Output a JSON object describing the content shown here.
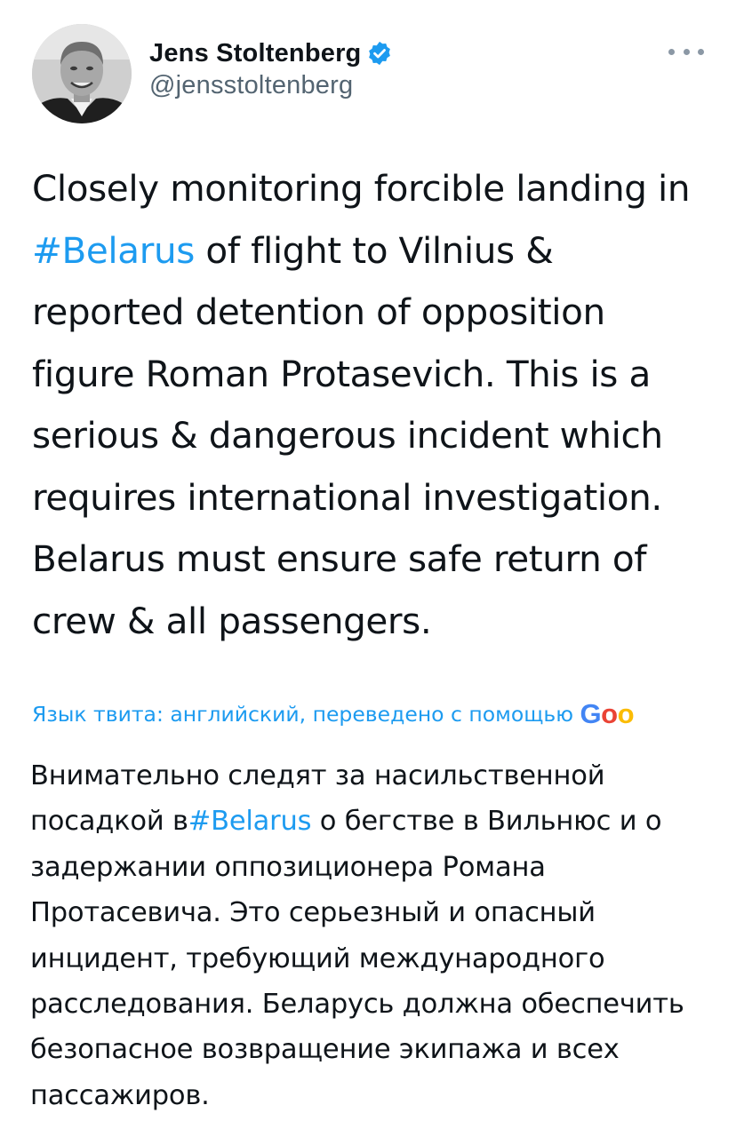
{
  "author": {
    "display_name": "Jens Stoltenberg",
    "handle": "@jensstoltenberg",
    "verified_icon": "verified-badge-icon",
    "avatar_icon": "profile-photo"
  },
  "more_icon": "more-options-icon",
  "tweet": {
    "lines": [
      {
        "before": "Closely monitoring forcible landing in",
        "hashtag": "",
        "after": ""
      },
      {
        "before": "",
        "hashtag": "#Belarus",
        "after": " of flight to Vilnius &"
      },
      {
        "before": "reported detention of opposition",
        "hashtag": "",
        "after": ""
      },
      {
        "before": "figure Roman Protasevich. This is a",
        "hashtag": "",
        "after": ""
      },
      {
        "before": "serious & dangerous incident which",
        "hashtag": "",
        "after": ""
      },
      {
        "before": "requires international investigation.",
        "hashtag": "",
        "after": ""
      },
      {
        "before": "Belarus must ensure safe return of",
        "hashtag": "",
        "after": ""
      },
      {
        "before": "crew & all passengers.",
        "hashtag": "",
        "after": ""
      }
    ]
  },
  "translate": {
    "label": "Язык твита: английский, переведено с помощью",
    "provider_logo_letters": [
      "G",
      "o",
      "o"
    ],
    "provider_colors": [
      "#4285f4",
      "#ea4335",
      "#fbbc05"
    ]
  },
  "translation": {
    "lines": [
      {
        "before": "Внимательно следят за насильственной",
        "hashtag": "",
        "after": ""
      },
      {
        "before": "посадкой в",
        "hashtag": "#Belarus",
        "after": " о бегстве в Вильнюс и о"
      },
      {
        "before": "задержании оппозиционера Романа",
        "hashtag": "",
        "after": ""
      },
      {
        "before": "Протасевича. Это серьезный и опасный",
        "hashtag": "",
        "after": ""
      },
      {
        "before": "инцидент, требующий международного",
        "hashtag": "",
        "after": ""
      },
      {
        "before": "расследования. Беларусь должна обеспечить",
        "hashtag": "",
        "after": ""
      },
      {
        "before": "безопасное возвращение экипажа и всех",
        "hashtag": "",
        "after": ""
      },
      {
        "before": "пассажиров.",
        "hashtag": "",
        "after": ""
      }
    ]
  },
  "colors": {
    "link": "#1d9bf0",
    "text": "#0f1419",
    "secondary": "#536471"
  }
}
